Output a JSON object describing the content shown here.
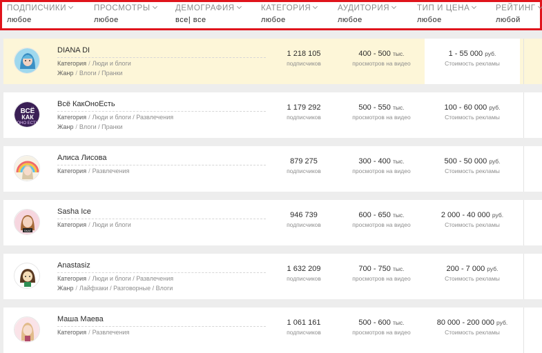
{
  "filters": [
    {
      "title": "ПОДПИСЧИКИ",
      "value": "любое"
    },
    {
      "title": "ПРОСМОТРЫ",
      "value": "любое"
    },
    {
      "title": "ДЕМОГРАФИЯ",
      "value": "все| все"
    },
    {
      "title": "КАТЕГОРИЯ",
      "value": "любое"
    },
    {
      "title": "АУДИТОРИЯ",
      "value": "любое"
    },
    {
      "title": "ТИП И ЦЕНА",
      "value": "любое"
    },
    {
      "title": "РЕЙТИНГ",
      "value": "любой"
    }
  ],
  "labels": {
    "category": "Категория",
    "genre": "Жанр",
    "subscribers": "подписчиков",
    "views": "просмотров на видео",
    "price": "Стоимость рекламы",
    "views_unit": "тыс.",
    "price_unit": "руб."
  },
  "channels": [
    {
      "name": "DIANA DI",
      "category": "Люди и блоги",
      "genre": "Влоги / Пранки",
      "subscribers": "1 218 105",
      "views": "400 - 500",
      "price": "1 - 55 000",
      "avatar": "blue-hair-girl-avatar"
    },
    {
      "name": "Всё КакОноЕсть",
      "category": "Люди и блоги / Развлечения",
      "genre": "Влоги / Пранки",
      "subscribers": "1 179 292",
      "views": "500 - 550",
      "price": "100 - 60 000",
      "avatar": "text-logo-avatar"
    },
    {
      "name": "Алиса Лисова",
      "category": "Развлечения",
      "genre": "",
      "subscribers": "879 275",
      "views": "300 - 400",
      "price": "500 - 50 000",
      "avatar": "rainbow-girl-avatar"
    },
    {
      "name": "Sasha Ice",
      "category": "Люди и блоги",
      "genre": "",
      "subscribers": "946 739",
      "views": "600 - 650",
      "price": "2 000 - 40 000",
      "avatar": "cartoon-girl-avatar"
    },
    {
      "name": "Anastasiz",
      "category": "Люди и блоги / Развлечения",
      "genre": "Лайфхаки / Разговорные / Влоги",
      "subscribers": "1 632 209",
      "views": "700 - 750",
      "price": "200 - 7 000",
      "avatar": "brown-hair-girl-avatar"
    },
    {
      "name": "Маша Маева",
      "category": "Развлечения",
      "genre": "",
      "subscribers": "1 061 161",
      "views": "500 - 600",
      "price": "80 000 - 200 000",
      "avatar": "blonde-girl-avatar"
    }
  ]
}
